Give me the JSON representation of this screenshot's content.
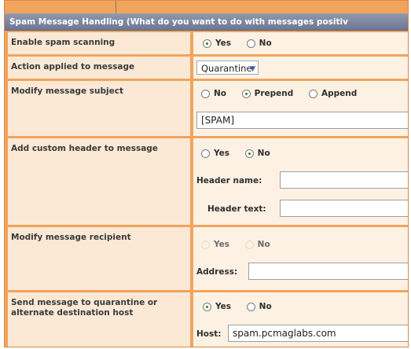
{
  "title": "Spam Message Handling (What do you want to do with messages positiv",
  "rows": [
    {
      "label": "Enable spam scanning",
      "options": [
        {
          "label": "Yes",
          "checked": true
        },
        {
          "label": "No",
          "checked": false
        }
      ]
    },
    {
      "label": "Action applied to message",
      "select_value": "Quarantine"
    },
    {
      "label": "Modify message subject",
      "options": [
        {
          "label": "No",
          "checked": false
        },
        {
          "label": "Prepend",
          "checked": true
        },
        {
          "label": "Append",
          "checked": false
        }
      ],
      "input_value": "[SPAM]"
    },
    {
      "label": "Add custom header to message",
      "options": [
        {
          "label": "Yes",
          "checked": false
        },
        {
          "label": "No",
          "checked": true
        }
      ],
      "header_name_label": "Header name:",
      "header_text_label": "Header text:"
    },
    {
      "label": "Modify message recipient",
      "options": [
        {
          "label": "Yes",
          "checked": false
        },
        {
          "label": "No",
          "checked": false
        }
      ],
      "address_label": "Address:"
    },
    {
      "label": "Send message to quarantine or alternate destination host",
      "options": [
        {
          "label": "Yes",
          "checked": true
        },
        {
          "label": "No",
          "checked": false
        }
      ],
      "host_label": "Host:",
      "host_value": "spam.pcmaglabs.com"
    }
  ]
}
